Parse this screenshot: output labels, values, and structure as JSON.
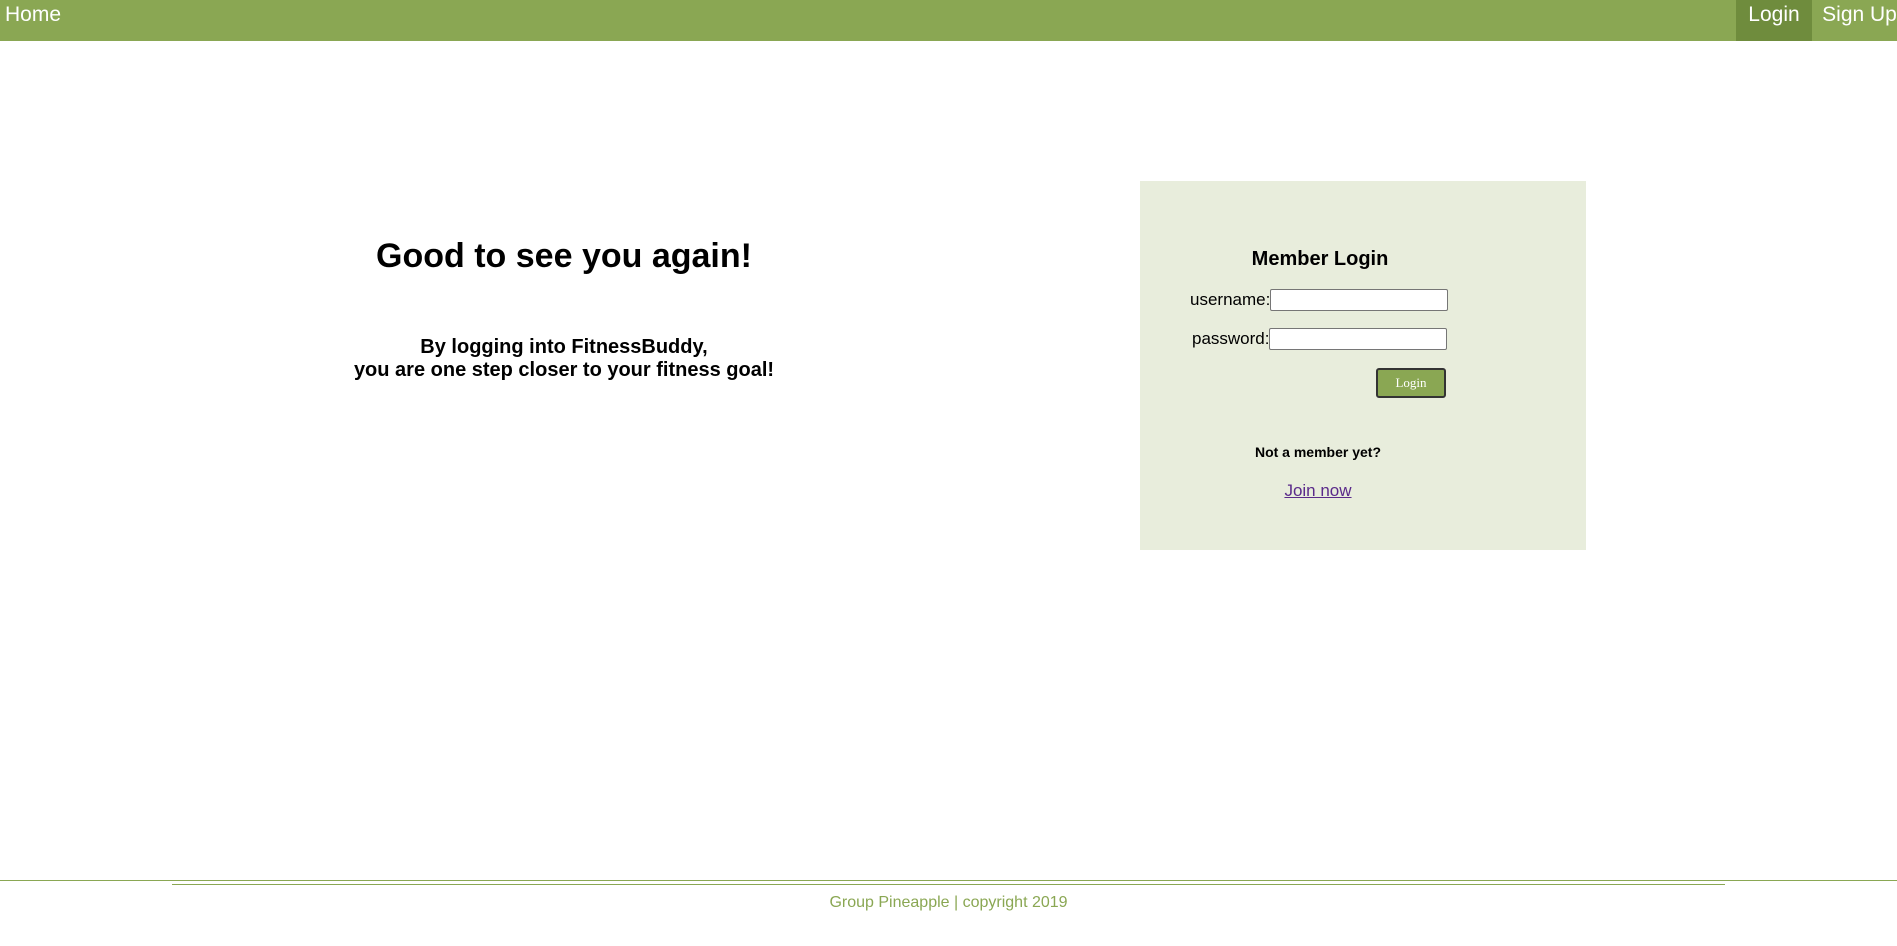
{
  "nav": {
    "home": "Home",
    "login": "Login",
    "signup": "Sign Up"
  },
  "welcome": {
    "title": "Good to see you again!",
    "line1": "By logging into FitnessBuddy,",
    "line2": "you are one step closer to your fitness goal!"
  },
  "login_form": {
    "title": "Member Login",
    "username_label": "username:",
    "username_value": "",
    "password_label": "password:",
    "password_value": "",
    "submit_label": "Login",
    "not_member": "Not a member yet?",
    "join_link": "Join now"
  },
  "footer": {
    "text": "Group Pineapple | copyright 2019"
  },
  "colors": {
    "brand": "#8aa753",
    "nav_active": "#6f8c3d",
    "panel_bg": "#e8eddc",
    "link": "#5a2a8a"
  }
}
